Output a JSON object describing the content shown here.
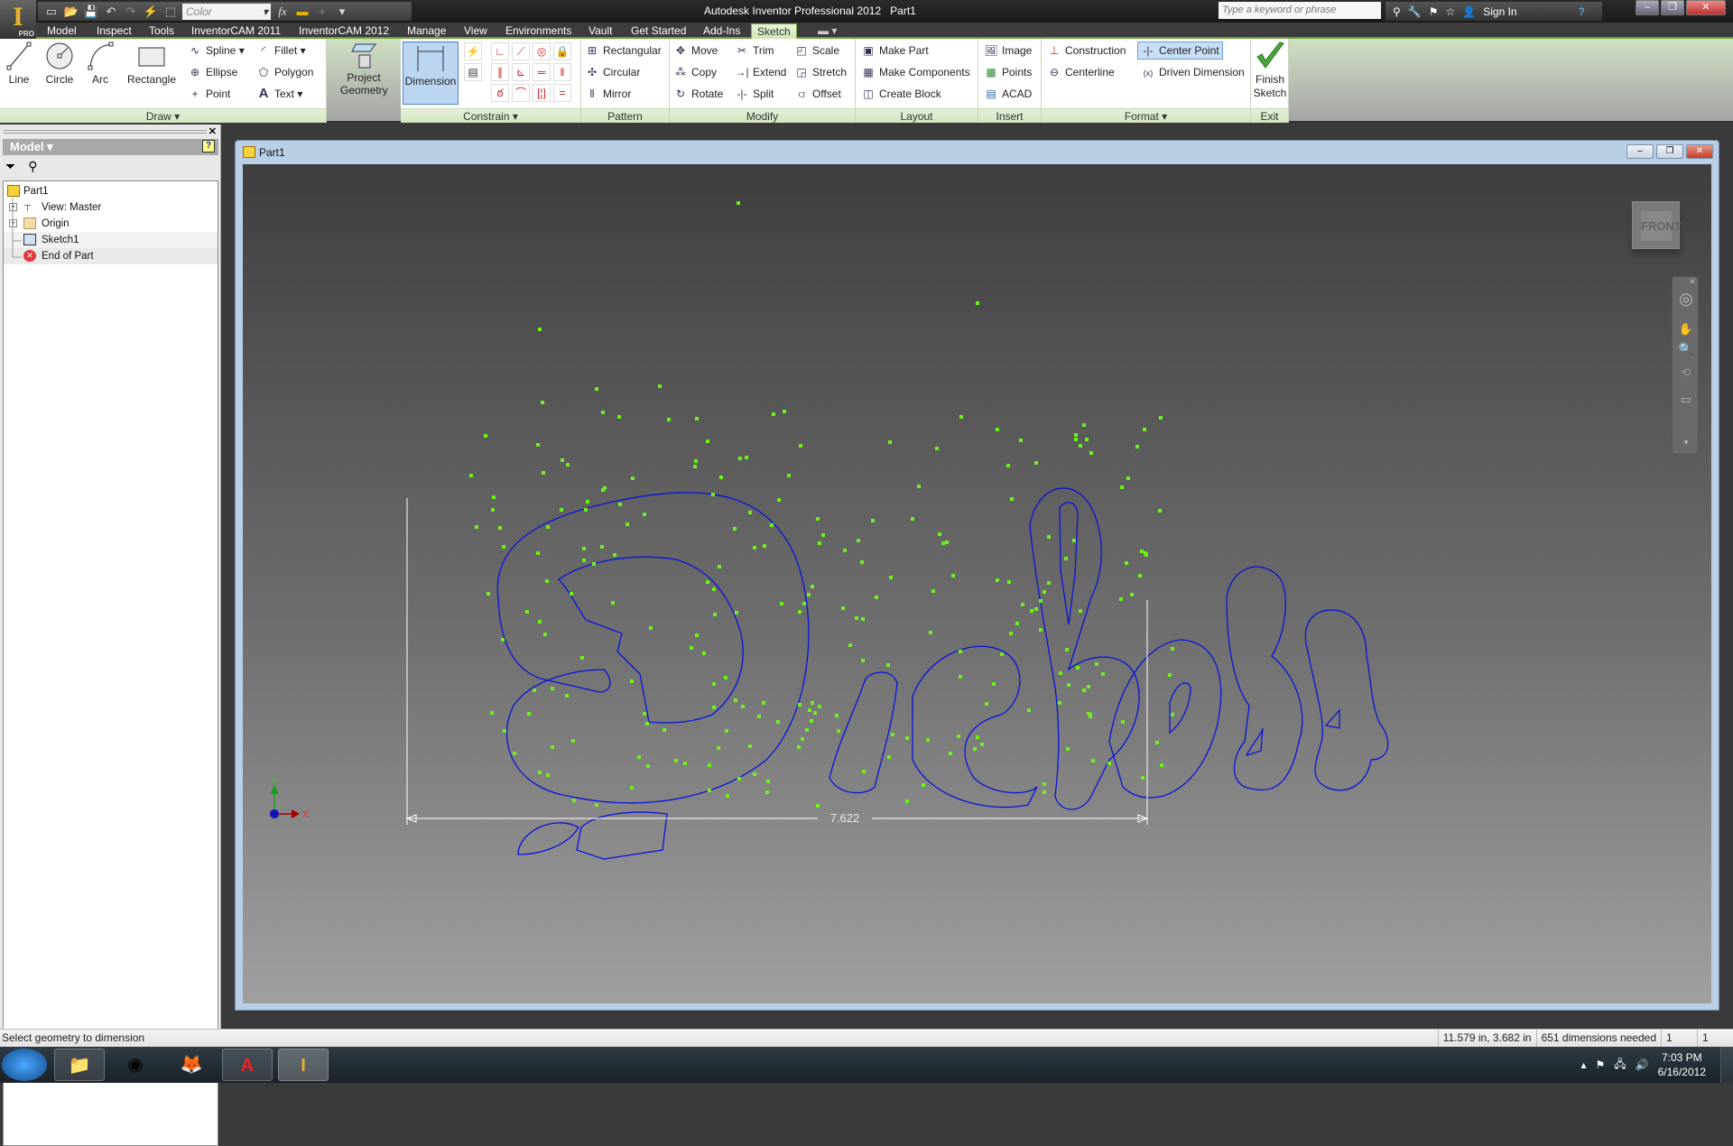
{
  "titlebar": {
    "app_title": "Autodesk Inventor Professional 2012",
    "doc_title": "Part1",
    "app_button_letter": "I",
    "app_button_badge": "PRO",
    "color_select": "Color",
    "search_placeholder": "Type a keyword or phrase",
    "sign_in": "Sign In",
    "qat_icons": [
      "new-icon",
      "open-icon",
      "save-icon",
      "undo-icon",
      "redo-icon",
      "update-icon",
      "select-icon",
      "fx-icon",
      "measure-icon",
      "plus-icon",
      "customize-icon"
    ]
  },
  "tabs": [
    {
      "label": "Model"
    },
    {
      "label": "Inspect"
    },
    {
      "label": "Tools"
    },
    {
      "label": "InventorCAM 2011"
    },
    {
      "label": "InventorCAM 2012"
    },
    {
      "label": "Manage"
    },
    {
      "label": "View"
    },
    {
      "label": "Environments"
    },
    {
      "label": "Vault"
    },
    {
      "label": "Get Started"
    },
    {
      "label": "Add-Ins"
    },
    {
      "label": "Sketch",
      "active": true
    }
  ],
  "ribbon": {
    "draw": {
      "label": "Draw",
      "line": "Line",
      "circle": "Circle",
      "arc": "Arc",
      "rectangle": "Rectangle",
      "spline": "Spline",
      "ellipse": "Ellipse",
      "point": "Point",
      "fillet": "Fillet",
      "polygon": "Polygon",
      "text": "Text",
      "project_geometry": "Project Geometry"
    },
    "constrain": {
      "label": "Constrain",
      "dimension": "Dimension"
    },
    "pattern": {
      "label": "Pattern",
      "rectangular": "Rectangular",
      "circular": "Circular",
      "mirror": "Mirror"
    },
    "modify": {
      "label": "Modify",
      "move": "Move",
      "copy": "Copy",
      "rotate": "Rotate",
      "trim": "Trim",
      "extend": "Extend",
      "split": "Split",
      "scale": "Scale",
      "stretch": "Stretch",
      "offset": "Offset"
    },
    "layout": {
      "label": "Layout",
      "make_part": "Make Part",
      "make_components": "Make Components",
      "create_block": "Create Block"
    },
    "insert": {
      "label": "Insert",
      "image": "Image",
      "points": "Points",
      "acad": "ACAD"
    },
    "format": {
      "label": "Format",
      "construction": "Construction",
      "centerline": "Centerline",
      "center_point": "Center Point",
      "driven_dimension": "Driven Dimension"
    },
    "exit": {
      "label": "Exit",
      "finish_line1": "Finish",
      "finish_line2": "Sketch"
    }
  },
  "browser": {
    "header": "Model",
    "tree": [
      {
        "label": "Part1",
        "icon": "part-icon"
      },
      {
        "label": "View: Master",
        "icon": "view-icon",
        "expandable": true
      },
      {
        "label": "Origin",
        "icon": "folder-icon",
        "expandable": true
      },
      {
        "label": "Sketch1",
        "icon": "sketch-icon",
        "highlighted": true
      },
      {
        "label": "End of Part",
        "icon": "end-of-part-icon"
      }
    ]
  },
  "graphics": {
    "window_title": "Part1",
    "viewcube_face": "FRONT",
    "dimension_value": "7.622",
    "sketch_text": "Dickes",
    "axis_x": "X",
    "axis_y": "Y",
    "colors": {
      "profile": "#0a14d8",
      "points": "#6cf21a",
      "dimension": "#ffffff"
    }
  },
  "status": {
    "prompt": "Select geometry to dimension",
    "coords": "11.579 in, 3.682 in",
    "dims_needed": "651 dimensions needed",
    "field1": "1",
    "field2": "1"
  },
  "taskbar": {
    "apps": [
      "start-orb",
      "windows-explorer",
      "chrome",
      "firefox",
      "autocad-mechanical",
      "inventor-pro"
    ],
    "time": "7:03 PM",
    "date": "6/16/2012"
  }
}
